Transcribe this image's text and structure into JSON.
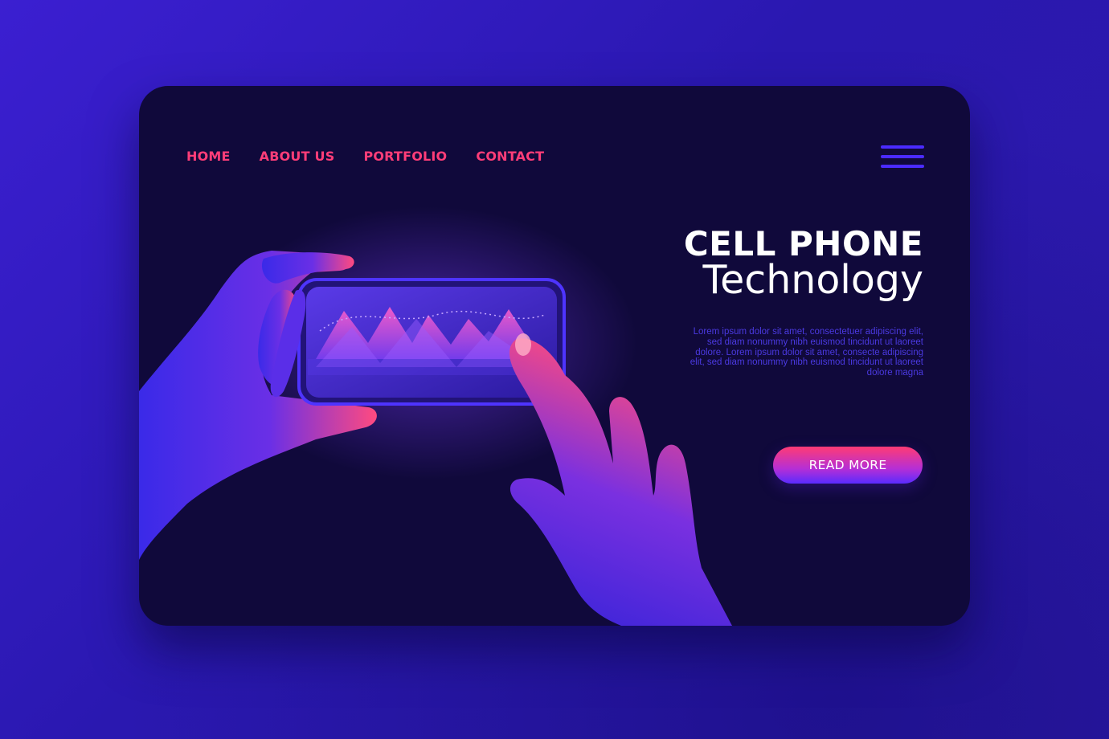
{
  "nav": {
    "items": [
      "HOME",
      "ABOUT US",
      "PORTFOLIO",
      "CONTACT"
    ]
  },
  "menu_icon": "hamburger-menu-icon",
  "hero": {
    "title_line1": "CELL PHONE",
    "title_line2": "Technology",
    "description": "Lorem ipsum dolor sit amet, consectetuer adipiscing elit, sed diam nonummy nibh euismod tincidunt ut laoreet dolore. Lorem ipsum dolor sit amet, consecte adipiscing elit, sed diam nonummy nibh euismod tincidunt ut laoreet dolore magna",
    "button_label": "READ MORE"
  },
  "colors": {
    "page_background": "#2f1ac0",
    "card_background": "#10093b",
    "nav_text": "#ff3d78",
    "accent_blue": "#4b2bff",
    "accent_pink": "#ff3b74",
    "title_text": "#ffffff"
  }
}
